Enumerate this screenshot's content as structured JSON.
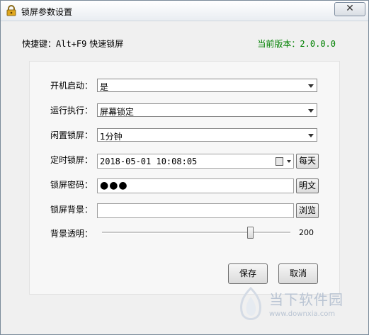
{
  "window": {
    "title": "锁屏参数设置",
    "close_glyph": "✕"
  },
  "shortcut": {
    "label": "快捷键：",
    "keys": "Alt+F9",
    "action": " 快速锁屏"
  },
  "version": {
    "label": "当前版本：",
    "value": "2.0.0.0"
  },
  "form": {
    "boot_start": {
      "label": "开机启动：",
      "value": "是"
    },
    "run_action": {
      "label": "运行执行：",
      "value": "屏幕锁定"
    },
    "idle_lock": {
      "label": "闲置锁屏：",
      "value": "1分钟"
    },
    "timed_lock": {
      "label": "定时锁屏：",
      "value": "2018-05-01  10:08:05",
      "button": "每天"
    },
    "password": {
      "label": "锁屏密码：",
      "value": "●●●",
      "button": "明文"
    },
    "background": {
      "label": "锁屏背景：",
      "value": "",
      "button": "浏览"
    },
    "opacity": {
      "label": "背景透明：",
      "value": 200,
      "min": 0,
      "max": 255,
      "display": "200"
    }
  },
  "actions": {
    "save": "保存",
    "cancel": "取消"
  },
  "watermark": {
    "name": "当下软件园",
    "url": "www.downxia.com"
  },
  "colors": {
    "version_text": "#008000",
    "title_gradient_top": "#ffffff",
    "window_bg": "#f0f0f0"
  }
}
